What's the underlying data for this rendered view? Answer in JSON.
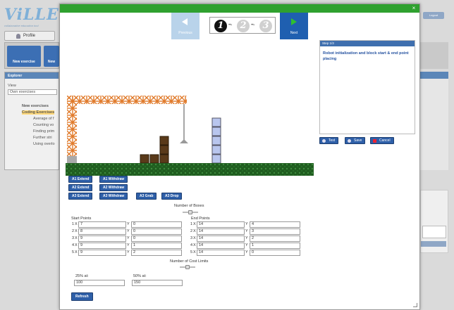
{
  "background": {
    "logo_text": "ViLLE",
    "logo_sub": "collaborative education tool",
    "profile_tab": "Profile",
    "logout": "Logout",
    "toolbar": [
      "New exercise",
      "New"
    ],
    "explorer_title": "Explorer",
    "view_label": "View",
    "view_select": "Own exercises",
    "tree": [
      "New exercises",
      "Coding Exercises",
      "Average of f",
      "Counting vo",
      "Finding prim",
      "Further stri",
      "Using overlo"
    ]
  },
  "wizard": {
    "prev_label": "Previous",
    "next_label": "Next",
    "steps": [
      "1",
      "2",
      "3"
    ],
    "active_step": 1
  },
  "side_panel": {
    "header": "Step 1/3",
    "text": "Robot initialization and block start & end point placing"
  },
  "side_buttons": {
    "test": "Test",
    "save": "Save",
    "cancel": "Cancel"
  },
  "world_buttons": [
    [
      "A1 Extend",
      "A1 Withdraw"
    ],
    [
      "A2 Extend",
      "A2 Withdraw"
    ],
    [
      "A3 Extend",
      "A3 Withdraw",
      "A3 Grab",
      "A3 Drop"
    ]
  ],
  "form": {
    "num_boxes_label": "Number of Boxes",
    "start_points_label": "Start Points",
    "end_points_label": "End Points",
    "start_points": [
      {
        "row": "1",
        "x": "7",
        "y": "0"
      },
      {
        "row": "2",
        "x": "8",
        "y": "0"
      },
      {
        "row": "3",
        "x": "9",
        "y": "0"
      },
      {
        "row": "4",
        "x": "9",
        "y": "1"
      },
      {
        "row": "5",
        "x": "9",
        "y": "2"
      }
    ],
    "end_points": [
      {
        "row": "1",
        "x": "14",
        "y": "4"
      },
      {
        "row": "2",
        "x": "14",
        "y": "3"
      },
      {
        "row": "3",
        "x": "14",
        "y": "2"
      },
      {
        "row": "4",
        "x": "14",
        "y": "1"
      },
      {
        "row": "5",
        "x": "14",
        "y": "0"
      }
    ],
    "cost_limits_label": "Number of Cost Limits",
    "limit1_label": "25% at:",
    "limit1_value": "100",
    "limit2_label": "50% at:",
    "limit2_value": "150",
    "refresh_label": "Refresh"
  },
  "colors": {
    "titlebar": "#2fa12f",
    "button": "#2e5fa8",
    "crane": "#e07a2a",
    "ground": "#1f5d1f",
    "box": "#5a3a1a",
    "target": "#b9c6ee"
  }
}
